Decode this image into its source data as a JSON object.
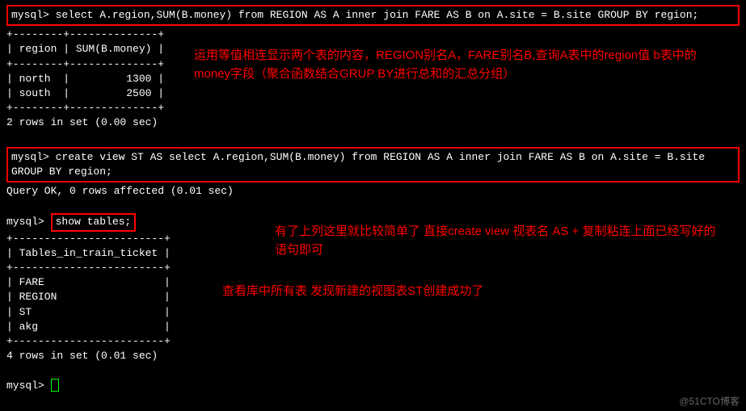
{
  "query1": {
    "prompt": "mysql> ",
    "sql": "select A.region,SUM(B.money) from REGION AS A inner join FARE AS B on A.site = B.site GROUP BY region;"
  },
  "table1": {
    "border": "+--------+--------------+",
    "header": "| region | SUM(B.money) |",
    "rows": [
      "| north  |         1300 |",
      "| south  |         2500 |"
    ],
    "footer": "2 rows in set (0.00 sec)"
  },
  "query2": {
    "prompt": "mysql> ",
    "sql": "create view ST AS select A.region,SUM(B.money) from REGION AS A inner join FARE AS B on A.site = B.site GROUP BY region;"
  },
  "result2": "Query OK, 0 rows affected (0.01 sec)",
  "query3": {
    "prompt": "mysql> ",
    "sql": "show tables;"
  },
  "table2": {
    "border": "+------------------------+",
    "header": "| Tables_in_train_ticket |",
    "rows": [
      "| FARE                   |",
      "| REGION                 |",
      "| ST                     |",
      "| akg                    |"
    ],
    "footer": "4 rows in set (0.01 sec)"
  },
  "final_prompt": "mysql> ",
  "annotations": {
    "anno1": "运用等值相连显示两个表的内容，REGION别名A，FARE别名B,查询A表中的region值 b表中的money字段（聚合函数结合GRUP BY进行总和的汇总分组）",
    "anno2": "有了上列这里就比较简单了 直接create view 视表名 AS + 复制粘连上面已经写好的语句即可",
    "anno3": "查看库中所有表 发现新建的视图表ST创建成功了"
  },
  "watermark": "@51CTO博客"
}
